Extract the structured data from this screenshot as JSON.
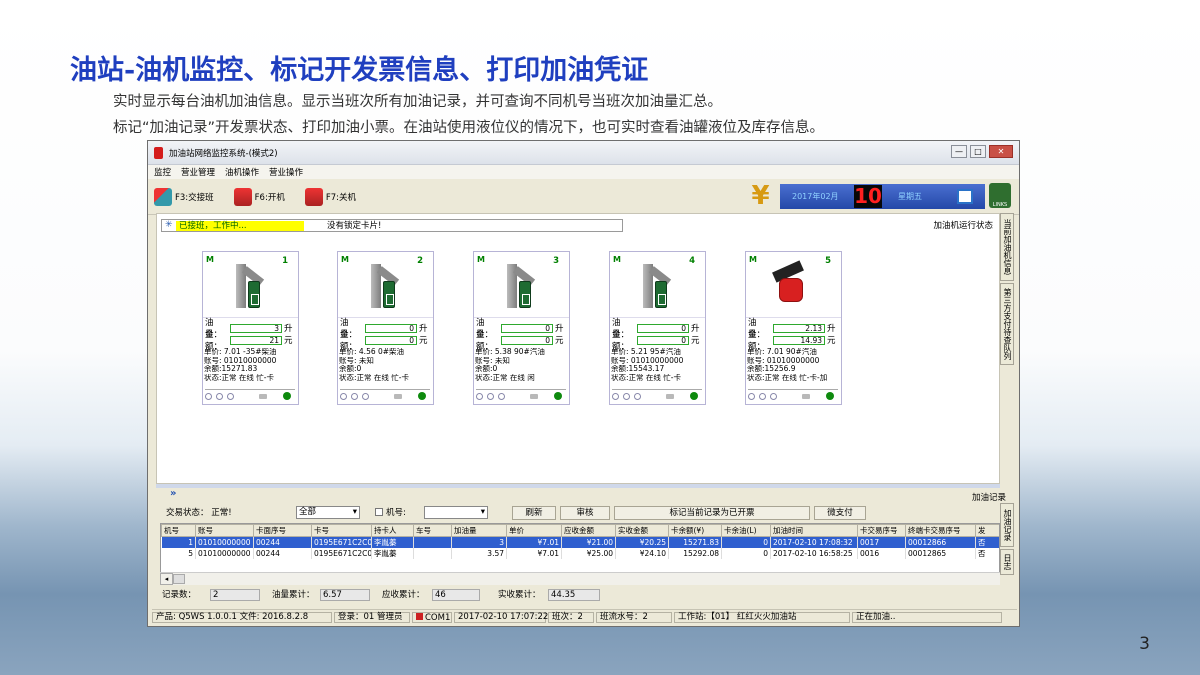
{
  "slide": {
    "title": "油站-油机监控、标记开发票信息、打印加油凭证",
    "desc1": "实时显示每台油机加油信息。显示当班次所有加油记录，并可查询不同机号当班次加油量汇总。",
    "desc2": "标记“加油记录”开发票状态、打印加油小票。在油站使用液位仪的情况下，也可实时查看油罐液位及库存信息。",
    "page": "3"
  },
  "window": {
    "title": "加油站网络监控系统-(模式2)",
    "min": "—",
    "max": "□",
    "close": "✕"
  },
  "menu": [
    "监控",
    "营业管理",
    "油机操作",
    "营业操作"
  ],
  "toolbar": {
    "shift": "F3:交接班",
    "open": "F6:开机",
    "close": "F7:关机",
    "yen": "¥",
    "date": "2017年02月",
    "day": "10",
    "weekday": "星期五",
    "links": "LINKS"
  },
  "status": {
    "icon": "✳",
    "on_duty": "已接班，工作中...",
    "card": "没有锁定卡片!",
    "run_status": "加油机运行状态"
  },
  "side_tabs": [
    "当前加油机信息",
    "第三方支付待查队列"
  ],
  "lower_side_tabs": [
    "加油记录",
    "日志"
  ],
  "pumps": [
    {
      "m": "M",
      "num": "1",
      "qty_label": "油量：",
      "qty": "3",
      "qty_unit": "升",
      "amt_label": "金额：",
      "amt": "21",
      "amt_unit": "元",
      "price": "单价: 7.01 -35#柴油",
      "account": "账号: 01010000000",
      "balance": "余额:15271.83",
      "state": "状态:正常 在线 忙-卡",
      "active": false
    },
    {
      "m": "M",
      "num": "2",
      "qty_label": "油量：",
      "qty": "0",
      "qty_unit": "升",
      "amt_label": "金额：",
      "amt": "0",
      "amt_unit": "元",
      "price": "单价: 4.56 0#柴油",
      "account": "账号: 未知",
      "balance": "余额:0",
      "state": "状态:正常 在线 忙-卡",
      "active": false
    },
    {
      "m": "M",
      "num": "3",
      "qty_label": "油量：",
      "qty": "0",
      "qty_unit": "升",
      "amt_label": "金额：",
      "amt": "0",
      "amt_unit": "元",
      "price": "单价: 5.38 90#汽油",
      "account": "账号: 未知",
      "balance": "余额:0",
      "state": "状态:正常 在线 闲",
      "active": false
    },
    {
      "m": "M",
      "num": "4",
      "qty_label": "油量：",
      "qty": "0",
      "qty_unit": "升",
      "amt_label": "金额：",
      "amt": "0",
      "amt_unit": "元",
      "price": "单价: 5.21 95#汽油",
      "account": "账号: 01010000000",
      "balance": "余额:15543.17",
      "state": "状态:正常 在线 忙-卡",
      "active": false
    },
    {
      "m": "M",
      "num": "5",
      "qty_label": "油量：",
      "qty": "2.13",
      "qty_unit": "升",
      "amt_label": "金额：",
      "amt": "14.93",
      "amt_unit": "元",
      "price": "单价: 7.01 90#汽油",
      "account": "账号: 01010000000",
      "balance": "余额:15256.9",
      "state": "状态:正常 在线 忙-卡-加",
      "active": true
    }
  ],
  "pump_icons": {
    "circle": "○",
    "disk": "▬",
    "green": "●"
  },
  "records": {
    "label": "加油记录",
    "chevron": "»"
  },
  "controls": {
    "trade_status": "交易状态： 正常!",
    "filter": "全部",
    "pump_no_label": "机号:",
    "refresh": "刷新",
    "review": "审核",
    "mark_invoice": "标记当前记录为已开票",
    "wechat": "微支付"
  },
  "table": {
    "headers": [
      "机号",
      "账号",
      "卡面序号",
      "卡号",
      "持卡人",
      "车号",
      "加油量",
      "单价",
      "应收金额",
      "实收金额",
      "卡余额(¥)",
      "卡余油(L)",
      "加油时间",
      "卡交易序号",
      "终端卡交易序号",
      "发"
    ],
    "rows": [
      [
        "1",
        "01010000000",
        "00244",
        "0195E671C2C0",
        "李胤蓁",
        "",
        "3",
        "¥7.01",
        "¥21.00",
        "¥20.25",
        "15271.83",
        "0",
        "2017-02-10 17:08:32",
        "0017",
        "00012866",
        "否"
      ],
      [
        "5",
        "01010000000",
        "00244",
        "0195E671C2C0",
        "李胤蓁",
        "",
        "3.57",
        "¥7.01",
        "¥25.00",
        "¥24.10",
        "15292.08",
        "0",
        "2017-02-10 16:58:25",
        "0016",
        "00012865",
        "否"
      ]
    ]
  },
  "totals": {
    "count_label": "记录数：",
    "count": "2",
    "qty_label": "油量累计：",
    "qty": "6.57",
    "recv_label": "应收累计：",
    "recv": "46",
    "paid_label": "实收累计：",
    "paid": "44.35"
  },
  "statusbar": {
    "product": "产品: Q5WS 1.0.0.1 文件: 2016.8.2.8",
    "login": "登录：01 管理员",
    "com": "COM1",
    "time": "2017-02-10 17:07:22",
    "shift": "班次：2",
    "serial": "班流水号：2",
    "station": "工作站:【01】 红红火火加油站",
    "state": "正在加油.."
  }
}
